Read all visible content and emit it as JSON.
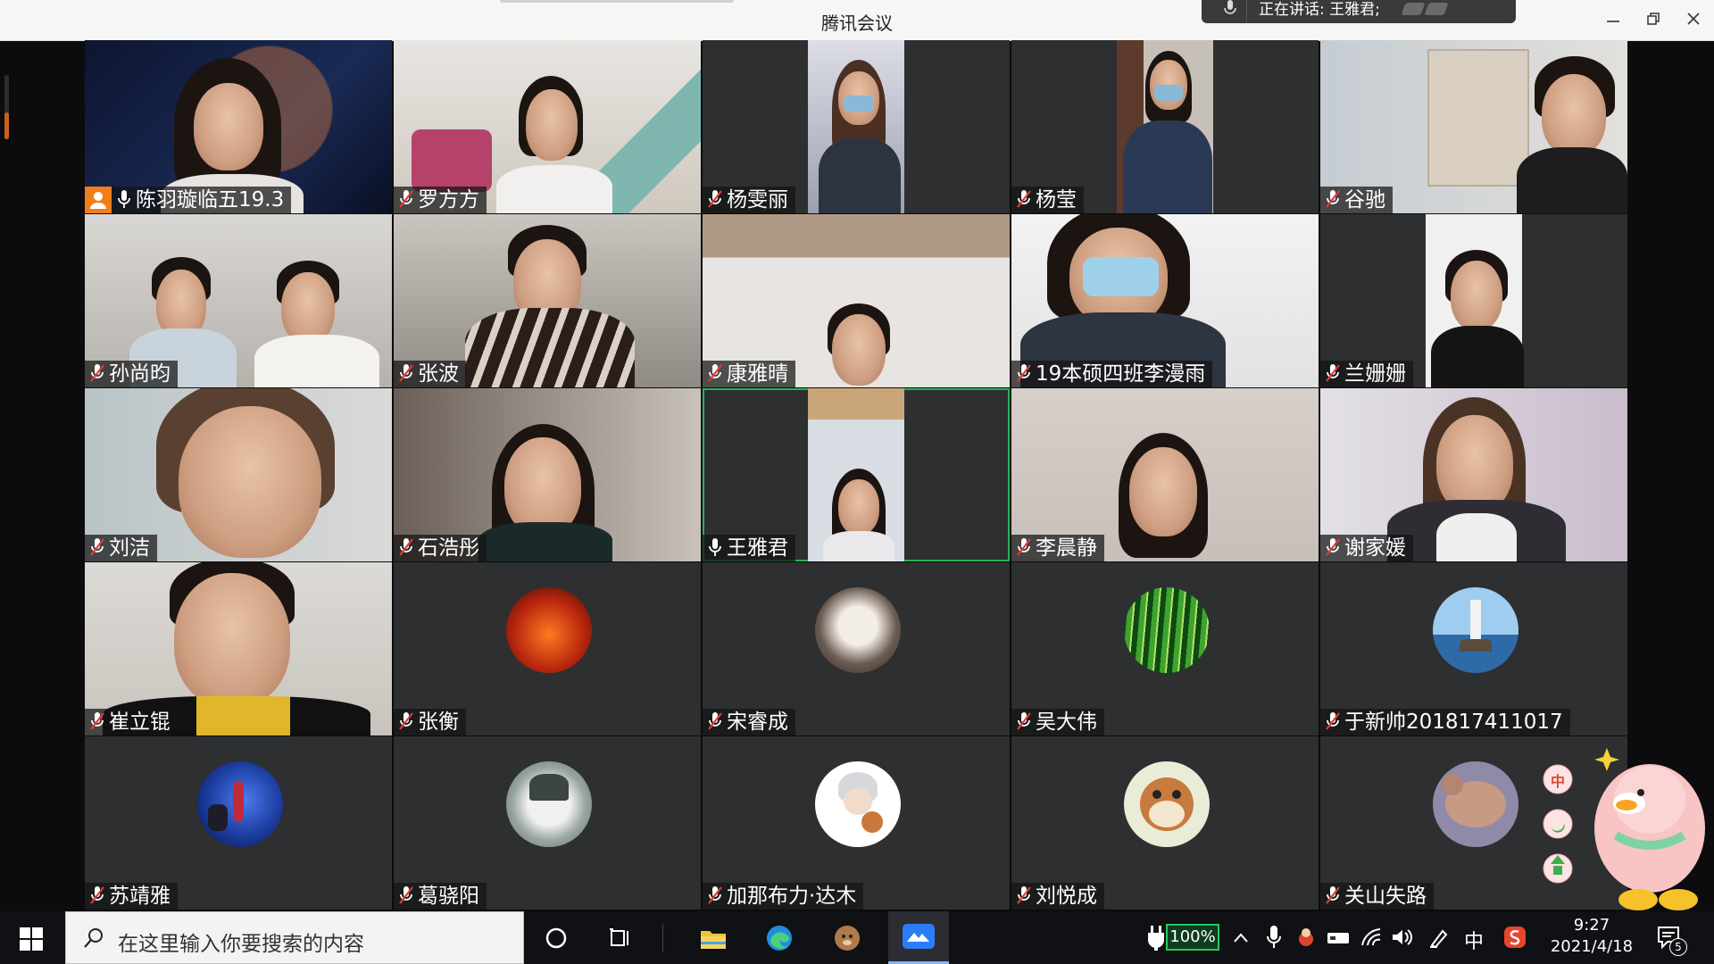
{
  "window": {
    "title": "腾讯会议",
    "speaking": "正在讲话: 王雅君;",
    "controls": [
      "minimize",
      "restore",
      "close"
    ]
  },
  "participants": [
    {
      "name": "陈羽璇临五19.3",
      "mic": "on",
      "host": true
    },
    {
      "name": "罗方方",
      "mic": "off"
    },
    {
      "name": "杨雯丽",
      "mic": "off"
    },
    {
      "name": "杨莹",
      "mic": "off"
    },
    {
      "name": "谷驰",
      "mic": "off"
    },
    {
      "name": "孙尚昀",
      "mic": "off"
    },
    {
      "name": "张波",
      "mic": "off"
    },
    {
      "name": "康雅晴",
      "mic": "off"
    },
    {
      "name": "19本硕四班李漫雨",
      "mic": "off"
    },
    {
      "name": "兰姗姗",
      "mic": "off"
    },
    {
      "name": "刘洁",
      "mic": "off"
    },
    {
      "name": "石浩彤",
      "mic": "off"
    },
    {
      "name": "王雅君",
      "mic": "on",
      "active": true
    },
    {
      "name": "李晨静",
      "mic": "off"
    },
    {
      "name": "谢家媛",
      "mic": "off"
    },
    {
      "name": "崔立锟",
      "mic": "off"
    },
    {
      "name": "张衡",
      "mic": "off"
    },
    {
      "name": "宋睿成",
      "mic": "off"
    },
    {
      "name": "吴大伟",
      "mic": "off"
    },
    {
      "name": "于新帅201817411017",
      "mic": "off"
    },
    {
      "name": "苏靖雅",
      "mic": "off"
    },
    {
      "name": "葛骁阳",
      "mic": "off"
    },
    {
      "name": "加那布力·达木",
      "mic": "off"
    },
    {
      "name": "刘悦成",
      "mic": "off"
    },
    {
      "name": "关山失路",
      "mic": "off"
    }
  ],
  "mascot": {
    "badge": "中"
  },
  "taskbar": {
    "search_placeholder": "在这里输入你要搜索的内容",
    "battery": "100%",
    "ime": "中",
    "time": "9:27",
    "date": "2021/4/18",
    "notification_count": "5"
  }
}
